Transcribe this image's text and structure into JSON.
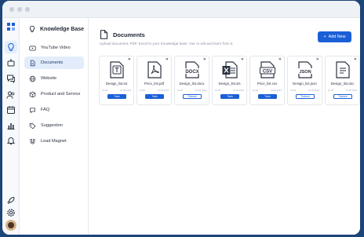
{
  "colors": {
    "accent": "#1a5fd6",
    "frame": "#1d4577",
    "active_bg": "#e2ecfb"
  },
  "rail": {
    "icons": [
      "logo-grid-icon",
      "bulb-icon",
      "robot-icon",
      "chat-icon",
      "users-icon",
      "calendar-icon",
      "chart-icon",
      "bell-icon",
      "rocket-icon",
      "gear-icon"
    ]
  },
  "sidebar": {
    "title": "Knowledge Base",
    "items": [
      {
        "label": "YouTube Video",
        "icon": "youtube-icon"
      },
      {
        "label": "Documents",
        "icon": "document-icon",
        "active": true
      },
      {
        "label": "Website",
        "icon": "globe-icon"
      },
      {
        "label": "Product and Service",
        "icon": "box-icon"
      },
      {
        "label": "FAQ",
        "icon": "chat-bubble-icon"
      },
      {
        "label": "Suggestion",
        "icon": "tag-icon"
      },
      {
        "label": "Lead Magnet",
        "icon": "magnet-icon"
      }
    ]
  },
  "main": {
    "title": "Documents",
    "subtitle": "Upload document, PDF, Excel to your Knowledge base. Our AI will and learn from it.",
    "add_button": "Add New",
    "add_icon": "+",
    "cards": [
      {
        "name": "Design_list.txt",
        "type": "txt",
        "date1": "10:48",
        "date2": "10:48 2024",
        "status": "Train"
      },
      {
        "name": "Price_list.pdf",
        "type": "pdf",
        "date1": "10:48",
        "date2": "10:48 2024",
        "status": "Train"
      },
      {
        "name": "Design_list.docx",
        "type": "DOCX",
        "date1": "10:48",
        "date2": "10:48 2024",
        "status": "Trained"
      },
      {
        "name": "Design_list.xls",
        "type": "xls",
        "date1": "10:48",
        "date2": "10:48 2024",
        "status": "Train"
      },
      {
        "name": "Price_list.csv",
        "type": "CSV",
        "date1": "10:48",
        "date2": "10:48 2024",
        "status": "Train"
      },
      {
        "name": "Design_list.json",
        "type": "JSON",
        "date1": "10:48",
        "date2": "10:48 2024",
        "status": "Trained"
      },
      {
        "name": "Design_list.doc",
        "type": "doc",
        "date1": "10:48",
        "date2": "10:48 2024",
        "status": "Trained"
      }
    ]
  }
}
